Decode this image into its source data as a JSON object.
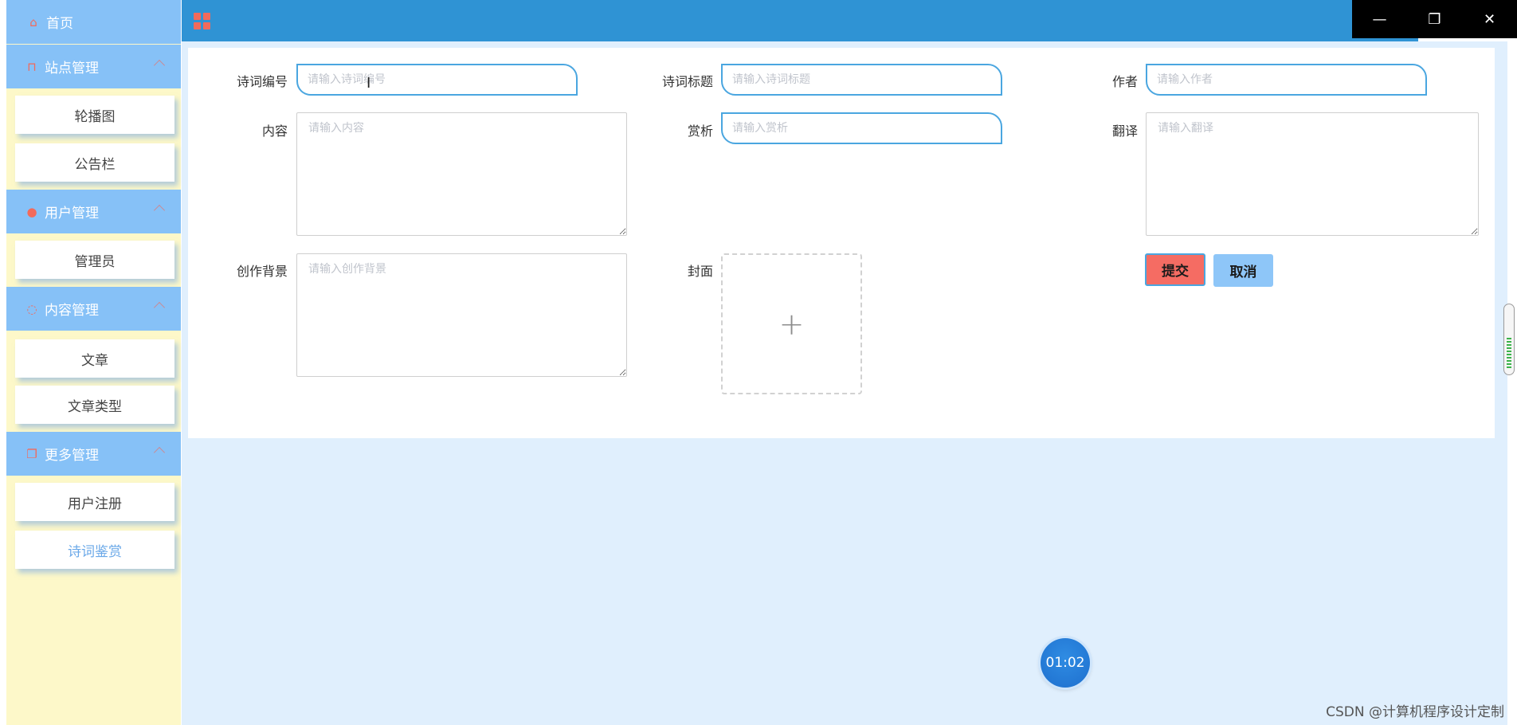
{
  "sidebar": {
    "home": "首页",
    "groups": [
      {
        "title": "站点管理",
        "icon": "bookmark-icon",
        "items": [
          "轮播图",
          "公告栏"
        ]
      },
      {
        "title": "用户管理",
        "icon": "user-icon",
        "items": [
          "管理员"
        ]
      },
      {
        "title": "内容管理",
        "icon": "chat-icon",
        "items": [
          "文章",
          "文章类型"
        ]
      },
      {
        "title": "更多管理",
        "icon": "copy-icon",
        "items": [
          "用户注册",
          "诗词鉴赏"
        ]
      }
    ],
    "active_item": "诗词鉴赏"
  },
  "form": {
    "labels": {
      "poem_no": "诗词编号",
      "poem_title": "诗词标题",
      "author": "作者",
      "content": "内容",
      "appreciation": "赏析",
      "translation": "翻译",
      "background": "创作背景",
      "cover": "封面"
    },
    "placeholders": {
      "poem_no": "请输入诗词编号",
      "poem_title": "请输入诗词标题",
      "author": "请输入作者",
      "content": "请输入内容",
      "appreciation": "请输入赏析",
      "translation": "请输入翻译",
      "background": "请输入创作背景"
    },
    "upload_glyph": "+",
    "submit_label": "提交",
    "cancel_label": "取消"
  },
  "window_controls": {
    "minimize": "—",
    "restore": "❐",
    "close": "✕"
  },
  "timer": "01:02",
  "watermark": "CSDN @计算机程序设计定制",
  "colors": {
    "header": "#2f93d4",
    "sidebar_head": "#86c1f7",
    "sidebar_bg": "#fdf8c9",
    "accent_red": "#f56c63",
    "content_bg": "#e0effd"
  }
}
